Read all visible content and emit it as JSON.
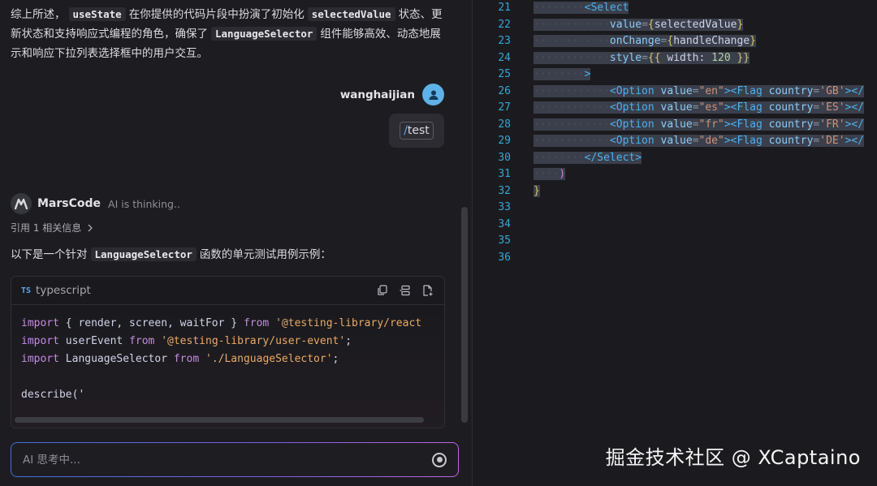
{
  "chat": {
    "summary": {
      "t1": "综上所述，",
      "c1": "useState",
      "t2": "在你提供的代码片段中扮演了初始化",
      "c2": "selectedValue",
      "t3": "状态、更新状态和支持响应式编程的角色，确保了",
      "c3": "LanguageSelector",
      "t4": "组件能够高效、动态地展示和响应下拉列表选择框中的用户交互。"
    },
    "user": {
      "name": "wanghaijian",
      "command_slash": "/",
      "command_text": "test"
    },
    "assistant": {
      "name": "MarsCode",
      "status": "AI is thinking..",
      "reference": "引用 1 相关信息",
      "intro_before": "以下是一个针对",
      "intro_code": "LanguageSelector",
      "intro_after": "函数的单元测试用例示例："
    },
    "code_block": {
      "badge": "TS",
      "language": "typescript",
      "lines": [
        [
          {
            "c": "kw",
            "t": "import"
          },
          {
            "c": "id",
            "t": " { render, screen, waitFor } "
          },
          {
            "c": "kw",
            "t": "from"
          },
          {
            "c": "str",
            "t": " '@testing-library/react"
          }
        ],
        [
          {
            "c": "kw",
            "t": "import"
          },
          {
            "c": "id",
            "t": " userEvent "
          },
          {
            "c": "kw",
            "t": "from"
          },
          {
            "c": "str",
            "t": " '@testing-library/user-event'"
          },
          {
            "c": "id",
            "t": ";"
          }
        ],
        [
          {
            "c": "kw",
            "t": "import"
          },
          {
            "c": "id",
            "t": " LanguageSelector "
          },
          {
            "c": "kw",
            "t": "from"
          },
          {
            "c": "str",
            "t": " './LanguageSelector'"
          },
          {
            "c": "id",
            "t": ";"
          }
        ],
        [],
        [
          {
            "c": "id",
            "t": "describe('"
          }
        ]
      ]
    },
    "input": {
      "placeholder": "AI 思考中..."
    }
  },
  "editor": {
    "line_numbers": [
      "21",
      "22",
      "23",
      "24",
      "25",
      "26",
      "27",
      "28",
      "29",
      "30",
      "31",
      "32",
      "33",
      "34",
      "35",
      "36"
    ],
    "lines": [
      {
        "sel": true,
        "tokens": [
          {
            "c": "dots",
            "t": "········"
          },
          {
            "c": "tag",
            "t": "<Select"
          }
        ]
      },
      {
        "sel": true,
        "tokens": [
          {
            "c": "dots",
            "t": "············"
          },
          {
            "c": "attr",
            "t": "value"
          },
          {
            "c": "pun",
            "t": "="
          },
          {
            "c": "brace",
            "t": "{"
          },
          {
            "c": "val",
            "t": "selectedValue"
          },
          {
            "c": "brace",
            "t": "}"
          }
        ]
      },
      {
        "sel": true,
        "tokens": [
          {
            "c": "dots",
            "t": "············"
          },
          {
            "c": "attr",
            "t": "onChange"
          },
          {
            "c": "pun",
            "t": "="
          },
          {
            "c": "brace",
            "t": "{"
          },
          {
            "c": "val",
            "t": "handleChange"
          },
          {
            "c": "brace",
            "t": "}"
          }
        ]
      },
      {
        "sel": true,
        "tokens": [
          {
            "c": "dots",
            "t": "············"
          },
          {
            "c": "attr",
            "t": "style"
          },
          {
            "c": "pun",
            "t": "="
          },
          {
            "c": "brace",
            "t": "{{"
          },
          {
            "c": "val",
            "t": " width: "
          },
          {
            "c": "num",
            "t": "120"
          },
          {
            "c": "brace",
            "t": " }}"
          }
        ]
      },
      {
        "sel": true,
        "tokens": [
          {
            "c": "dots",
            "t": "········"
          },
          {
            "c": "tag",
            "t": ">"
          }
        ]
      },
      {
        "sel": true,
        "tokens": [
          {
            "c": "dots",
            "t": "············"
          },
          {
            "c": "tag",
            "t": "<Option"
          },
          {
            "c": "attr",
            "t": " value"
          },
          {
            "c": "pun",
            "t": "="
          },
          {
            "c": "strv",
            "t": "\"en\""
          },
          {
            "c": "tag",
            "t": "><Flag"
          },
          {
            "c": "attr",
            "t": " country"
          },
          {
            "c": "pun",
            "t": "="
          },
          {
            "c": "strv",
            "t": "'GB'"
          },
          {
            "c": "tag",
            "t": "></"
          }
        ]
      },
      {
        "sel": true,
        "tokens": [
          {
            "c": "dots",
            "t": "············"
          },
          {
            "c": "tag",
            "t": "<Option"
          },
          {
            "c": "attr",
            "t": " value"
          },
          {
            "c": "pun",
            "t": "="
          },
          {
            "c": "strv",
            "t": "\"es\""
          },
          {
            "c": "tag",
            "t": "><Flag"
          },
          {
            "c": "attr",
            "t": " country"
          },
          {
            "c": "pun",
            "t": "="
          },
          {
            "c": "strv",
            "t": "'ES'"
          },
          {
            "c": "tag",
            "t": "></"
          }
        ]
      },
      {
        "sel": true,
        "tokens": [
          {
            "c": "dots",
            "t": "············"
          },
          {
            "c": "tag",
            "t": "<Option"
          },
          {
            "c": "attr",
            "t": " value"
          },
          {
            "c": "pun",
            "t": "="
          },
          {
            "c": "strv",
            "t": "\"fr\""
          },
          {
            "c": "tag",
            "t": "><Flag"
          },
          {
            "c": "attr",
            "t": " country"
          },
          {
            "c": "pun",
            "t": "="
          },
          {
            "c": "strv",
            "t": "'FR'"
          },
          {
            "c": "tag",
            "t": "></"
          }
        ]
      },
      {
        "sel": true,
        "tokens": [
          {
            "c": "dots",
            "t": "············"
          },
          {
            "c": "tag",
            "t": "<Option"
          },
          {
            "c": "attr",
            "t": " value"
          },
          {
            "c": "pun",
            "t": "="
          },
          {
            "c": "strv",
            "t": "\"de\""
          },
          {
            "c": "tag",
            "t": "><Flag"
          },
          {
            "c": "attr",
            "t": " country"
          },
          {
            "c": "pun",
            "t": "="
          },
          {
            "c": "strv",
            "t": "'DE'"
          },
          {
            "c": "tag",
            "t": "></"
          }
        ]
      },
      {
        "sel": true,
        "tokens": [
          {
            "c": "dots",
            "t": "········"
          },
          {
            "c": "tag",
            "t": "</Select>"
          }
        ]
      },
      {
        "sel": true,
        "tokens": [
          {
            "c": "dots",
            "t": "····"
          },
          {
            "c": "paren",
            "t": ")"
          }
        ]
      },
      {
        "sel": true,
        "tokens": [
          {
            "c": "brace",
            "t": "}"
          }
        ]
      },
      {
        "sel": false,
        "tokens": []
      },
      {
        "sel": false,
        "tokens": []
      },
      {
        "sel": false,
        "tokens": []
      },
      {
        "sel": false,
        "tokens": []
      }
    ]
  },
  "watermark": "掘金技术社区 @ XCaptaino"
}
